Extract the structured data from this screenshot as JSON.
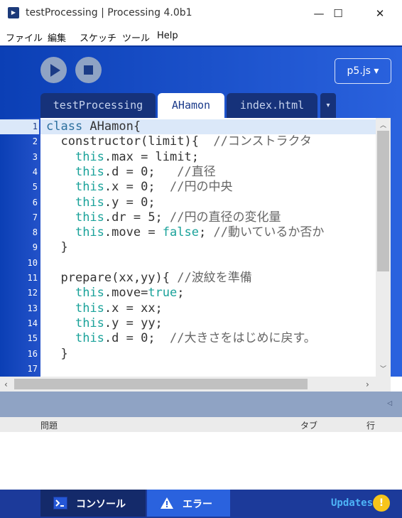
{
  "window": {
    "title": "testProcessing | Processing 4.0b1",
    "minimize": "—",
    "maximize": "☐",
    "close": "✕"
  },
  "menu": [
    "ファイル",
    "編集",
    "スケッチ",
    "ツール",
    "Help"
  ],
  "toolbar": {
    "mode_label": "p5.js ▾"
  },
  "tabs": [
    {
      "label": "testProcessing"
    },
    {
      "label": "AHamon"
    },
    {
      "label": "index.html"
    }
  ],
  "tab_menu_glyph": "▾",
  "editor": {
    "current_line": 1,
    "lines": [
      {
        "n": "1",
        "code": "class AHamon{"
      },
      {
        "n": "2",
        "code": "  constructor(limit){  //コンストラクタ"
      },
      {
        "n": "3",
        "code": "    this.max = limit;"
      },
      {
        "n": "4",
        "code": "    this.d = 0;   //直径"
      },
      {
        "n": "5",
        "code": "    this.x = 0;  //円の中央"
      },
      {
        "n": "6",
        "code": "    this.y = 0;"
      },
      {
        "n": "7",
        "code": "    this.dr = 5; //円の直径の変化量"
      },
      {
        "n": "8",
        "code": "    this.move = false; //動いているか否か"
      },
      {
        "n": "9",
        "code": "  }"
      },
      {
        "n": "10",
        "code": ""
      },
      {
        "n": "11",
        "code": "  prepare(xx,yy){ //波紋を準備"
      },
      {
        "n": "12",
        "code": "    this.move=true;"
      },
      {
        "n": "13",
        "code": "    this.x = xx;"
      },
      {
        "n": "14",
        "code": "    this.y = yy;"
      },
      {
        "n": "15",
        "code": "    this.d = 0;  //大きさをはじめに戻す。"
      },
      {
        "n": "16",
        "code": "  }"
      },
      {
        "n": "17",
        "code": ""
      }
    ]
  },
  "messages": {
    "col_problem": "問題",
    "col_tab": "タブ",
    "col_line": "行"
  },
  "footer": {
    "console_label": "コンソール",
    "error_label": "エラー",
    "updates_label": "Updates",
    "updates_badge": "!"
  },
  "colors": {
    "keyword": "#2b6f9e",
    "this": "#1aa29a",
    "bool": "#1aa29a",
    "comment": "#666666",
    "text": "#333333"
  }
}
